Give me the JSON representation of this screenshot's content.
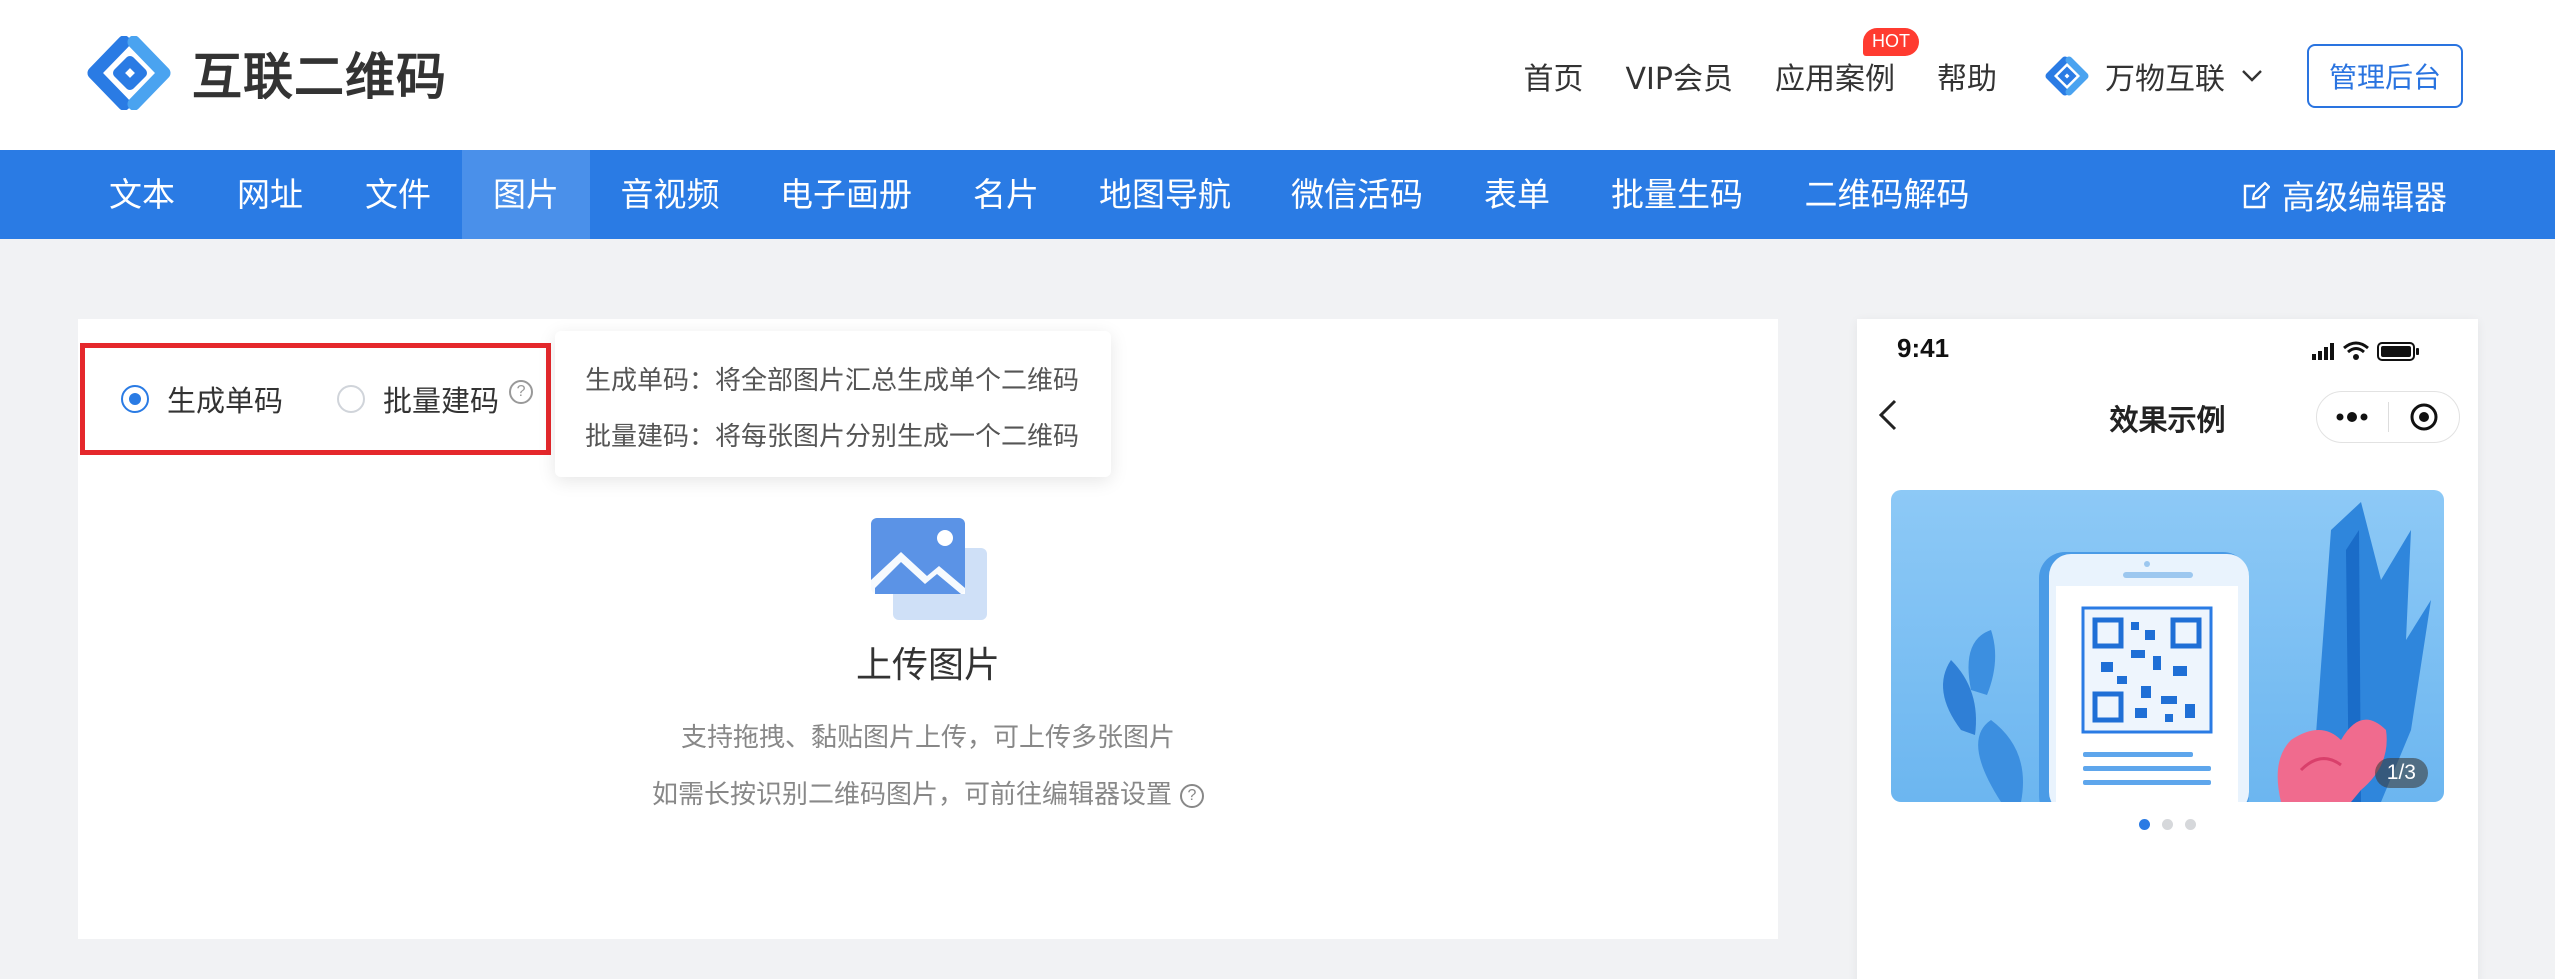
{
  "header": {
    "brand": "互联二维码",
    "nav": [
      {
        "label": "首页"
      },
      {
        "label": "VIP会员"
      },
      {
        "label": "应用案例",
        "badge": "HOT"
      },
      {
        "label": "帮助"
      }
    ],
    "org_switcher": "万物互联",
    "admin_button": "管理后台"
  },
  "menubar": {
    "items": [
      "文本",
      "网址",
      "文件",
      "图片",
      "音视频",
      "电子画册",
      "名片",
      "地图导航",
      "微信活码",
      "表单",
      "批量生码",
      "二维码解码"
    ],
    "active": "图片",
    "advanced_editor": "高级编辑器"
  },
  "main": {
    "modes": {
      "single": "生成单码",
      "batch": "批量建码",
      "selected": "single"
    },
    "tooltip": {
      "line1": "生成单码：将全部图片汇总生成单个二维码",
      "line2": "批量建码：将每张图片分别生成一个二维码"
    },
    "upload": {
      "title": "上传图片",
      "hint1": "支持拖拽、黏贴图片上传，可上传多张图片",
      "hint2": "如需长按识别二维码图片，可前往编辑器设置"
    }
  },
  "preview": {
    "status_time": "9:41",
    "title": "效果示例",
    "page_indicator": "1/3",
    "slides_total": 3,
    "slide_active": 1
  },
  "colors": {
    "primary": "#2a7be4",
    "highlight_border": "#e5282c",
    "hot_badge": "#ff3b30"
  }
}
